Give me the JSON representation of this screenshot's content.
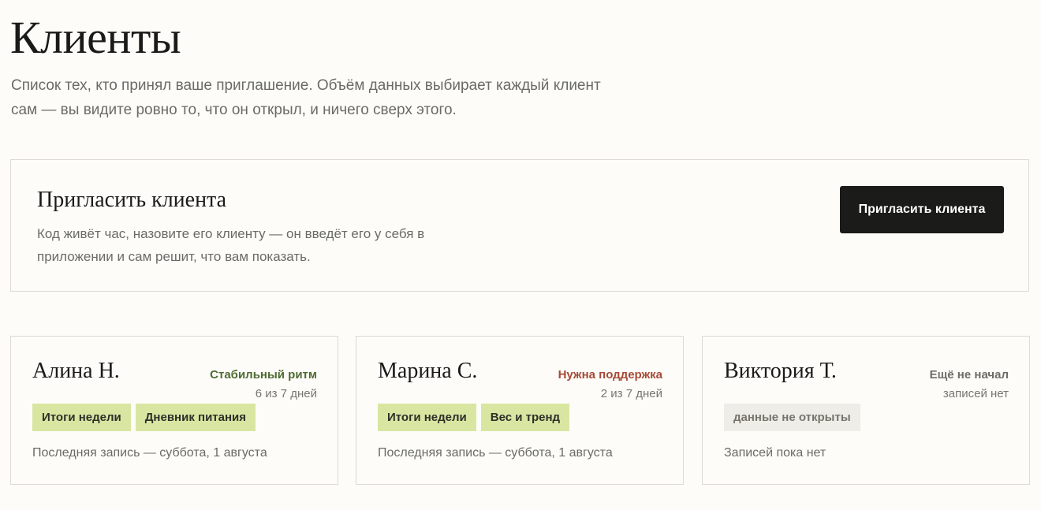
{
  "header": {
    "title": "Клиенты",
    "subtitle": "Список тех, кто принял ваше приглашение. Объём данных выбирает каждый клиент сам — вы видите ровно то, что он открыл, и ничего сверх этого."
  },
  "invite": {
    "title": "Пригласить клиента",
    "description": "Код живёт час, назовите его клиенту — он введёт его у себя в приложении и сам решит, что вам показать.",
    "button_label": "Пригласить клиента"
  },
  "colors": {
    "status_ok": "#4e6b32",
    "status_alert": "#a64a36",
    "status_neutral": "#6e6d66",
    "tag_active_bg": "#d9e6a2",
    "tag_muted_bg": "#efede7",
    "button_bg": "#1b1b19"
  },
  "clients": [
    {
      "name": "Алина Н.",
      "status": "Стабильный ритм",
      "days": "6 из 7 дней",
      "tags": [
        "Итоги недели",
        "Дневник питания"
      ],
      "last_entry": "Последняя запись — суббота, 1 августа"
    },
    {
      "name": "Марина С.",
      "status": "Нужна поддержка",
      "days": "2 из 7 дней",
      "tags": [
        "Итоги недели",
        "Вес и тренд"
      ],
      "last_entry": "Последняя запись — суббота, 1 августа"
    },
    {
      "name": "Виктория Т.",
      "status": "Ещё не начал",
      "days": "записей нет",
      "tags": [
        "данные не открыты"
      ],
      "last_entry": "Записей пока нет"
    }
  ]
}
